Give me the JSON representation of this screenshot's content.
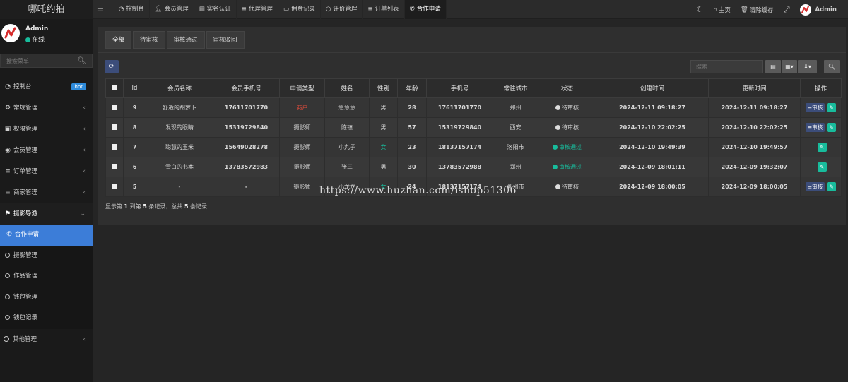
{
  "sidebar": {
    "brand": "哪吒约拍",
    "user": {
      "name": "Admin",
      "status": "在线"
    },
    "search_placeholder": "搜索菜单",
    "items": [
      {
        "label": "控制台",
        "icon": "dashboard-icon",
        "badge": "hot"
      },
      {
        "label": "常规管理",
        "icon": "cogs-icon"
      },
      {
        "label": "权限管理",
        "icon": "group-icon"
      },
      {
        "label": "会员管理",
        "icon": "user-circle-icon"
      },
      {
        "label": "订单管理",
        "icon": "list-icon"
      },
      {
        "label": "商家管理",
        "icon": "list-icon"
      },
      {
        "label": "摄影导游",
        "icon": "flag-icon",
        "open": true
      },
      {
        "label": "其他管理",
        "icon": "circle-icon"
      }
    ],
    "subitems": [
      {
        "label": "合作申请",
        "active": true,
        "icon": "whatsapp-icon"
      },
      {
        "label": "摄影管理"
      },
      {
        "label": "作品管理"
      },
      {
        "label": "钱包管理"
      },
      {
        "label": "钱包记录"
      }
    ]
  },
  "topbar": {
    "tabs": [
      {
        "label": "控制台",
        "icon": "dashboard-icon"
      },
      {
        "label": "会员管理",
        "icon": "user-icon"
      },
      {
        "label": "实名认证",
        "icon": "id-card-icon"
      },
      {
        "label": "代理管理",
        "icon": "list-icon"
      },
      {
        "label": "佣金记录",
        "icon": "money-icon"
      },
      {
        "label": "评价管理",
        "icon": "circle-icon"
      },
      {
        "label": "订单列表",
        "icon": "list-icon"
      },
      {
        "label": "合作申请",
        "icon": "whatsapp-icon",
        "active": true
      }
    ],
    "home": "主页",
    "clear_cache": "清除缓存",
    "admin": "Admin"
  },
  "filter_tabs": [
    "全部",
    "待审核",
    "审核通过",
    "审核驳回"
  ],
  "search_placeholder": "搜索",
  "table": {
    "headers": [
      "Id",
      "会员名称",
      "会员手机号",
      "申请类型",
      "姓名",
      "性别",
      "年龄",
      "手机号",
      "常驻城市",
      "状态",
      "创建时间",
      "更新时间",
      "操作"
    ],
    "rows": [
      {
        "id": "9",
        "member": "舒适的胡萝卜",
        "member_phone": "17611701770",
        "type": "商户",
        "name": "急急急",
        "gender": "男",
        "age": "28",
        "phone": "17611701770",
        "city": "郑州",
        "status": "待审核",
        "created": "2024-12-11 09:18:27",
        "updated": "2024-12-11 09:18:27",
        "review": "审核"
      },
      {
        "id": "8",
        "member": "发现的眼睛",
        "member_phone": "15319729840",
        "type": "摄影师",
        "name": "陈镇",
        "gender": "男",
        "age": "57",
        "phone": "15319729840",
        "city": "西安",
        "status": "待审核",
        "created": "2024-12-10 22:02:25",
        "updated": "2024-12-10 22:02:25",
        "review": "审核"
      },
      {
        "id": "7",
        "member": "聪慧的玉米",
        "member_phone": "15649028278",
        "type": "摄影师",
        "name": "小丸子",
        "gender": "女",
        "age": "23",
        "phone": "18137157174",
        "city": "洛阳市",
        "status": "审核通过",
        "created": "2024-12-10 19:49:39",
        "updated": "2024-12-10 19:49:57",
        "review": ""
      },
      {
        "id": "6",
        "member": "雪白的书本",
        "member_phone": "13783572983",
        "type": "摄影师",
        "name": "张三",
        "gender": "男",
        "age": "30",
        "phone": "13783572988",
        "city": "郑州",
        "status": "审核通过",
        "created": "2024-12-09 18:01:11",
        "updated": "2024-12-09 19:32:07",
        "review": ""
      },
      {
        "id": "5",
        "member": "-",
        "member_phone": "-",
        "type": "摄影师",
        "name": "小龙龙",
        "gender": "女",
        "age": "24",
        "phone": "18137157174",
        "city": "郑州市",
        "status": "待审核",
        "created": "2024-12-09 18:00:05",
        "updated": "2024-12-09 18:00:05",
        "review": "审核"
      }
    ]
  },
  "pager": {
    "prefix": "显示第 ",
    "from": "1",
    "mid1": " 到第 ",
    "to": "5",
    "mid2": " 条记录，总共 ",
    "total": "5",
    "suffix": " 条记录"
  },
  "watermark": "https://www.huzhan.com/ishop51306",
  "colors": {
    "accent": "#3c7dd8",
    "success": "#18bc9c",
    "danger": "#e74c3c",
    "pending": "#dddddd"
  }
}
